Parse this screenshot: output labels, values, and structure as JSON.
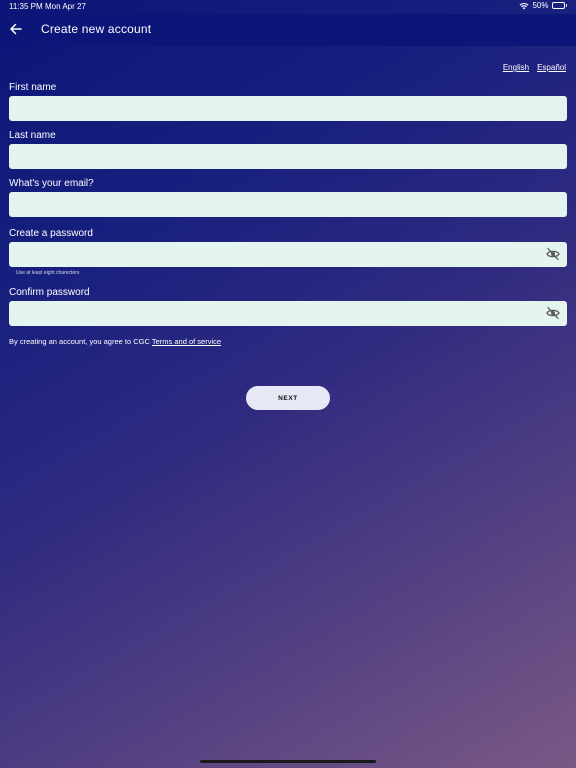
{
  "status_bar": {
    "time": "11:35 PM",
    "date": "Mon Apr 27",
    "battery": "50%",
    "battery_level": 0.5
  },
  "header": {
    "back_icon": "arrow-left-icon",
    "title": "Create new account"
  },
  "language": {
    "english": "English",
    "spanish": "Español"
  },
  "form": {
    "first_name": {
      "label": "First name",
      "value": "",
      "placeholder": ""
    },
    "last_name": {
      "label": "Last name",
      "value": "",
      "placeholder": ""
    },
    "email": {
      "label": "What's your email?",
      "value": "",
      "placeholder": ""
    },
    "password": {
      "label": "Create a password",
      "value": "",
      "placeholder": "",
      "helper": "Use at least eight charecters",
      "toggle_icon": "eye-off-icon"
    },
    "confirm_password": {
      "label": "Confirm password",
      "value": "",
      "placeholder": "",
      "toggle_icon": "eye-off-icon"
    }
  },
  "terms": {
    "text": "By creating an account, you agree to CGC ",
    "link": "Terms and of service"
  },
  "next_button": {
    "label": "NEXT"
  },
  "colors": {
    "header_bg": "#0c1578",
    "input_bg": "#e4f4ef",
    "button_bg": "#e6e8f5",
    "gradient_start": "#0c1578",
    "gradient_end": "#7a5885"
  }
}
